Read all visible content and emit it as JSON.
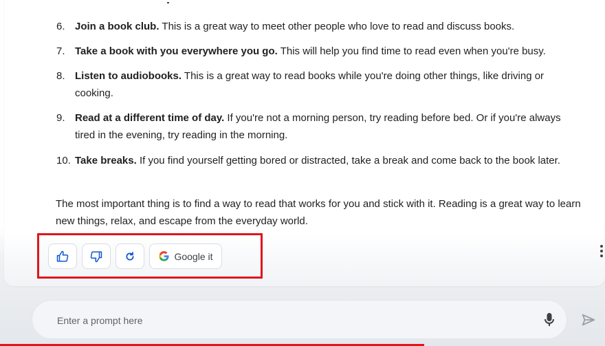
{
  "list_items": [
    {
      "num": "6.",
      "bold": "Join a book club.",
      "text": " This is a great way to meet other people who love to read and discuss books."
    },
    {
      "num": "7.",
      "bold": "Take a book with you everywhere you go.",
      "text": " This will help you find time to read even when you're busy."
    },
    {
      "num": "8.",
      "bold": "Listen to audiobooks.",
      "text": " This is a great way to read books while you're doing other things, like driving or cooking."
    },
    {
      "num": "9.",
      "bold": "Read at a different time of day.",
      "text": " If you're not a morning person, try reading before bed. Or if you're always tired in the evening, try reading in the morning."
    },
    {
      "num": "10.",
      "bold": "Take breaks.",
      "text": " If you find yourself getting bored or distracted, take a break and come back to the book later."
    }
  ],
  "conclusion": "The most important thing is to find a way to read that works for you and stick with it. Reading is a great way to learn new things, relax, and escape from the everyday world.",
  "actions": {
    "thumbs_up_icon": "thumbs-up-icon",
    "thumbs_down_icon": "thumbs-down-icon",
    "regenerate_icon": "refresh-icon",
    "google_label": "Google it"
  },
  "prompt": {
    "placeholder": "Enter a prompt here"
  },
  "colors": {
    "accent_blue": "#0b57d0",
    "highlight_red": "#e0141e",
    "progress_red": "#e0141e"
  }
}
